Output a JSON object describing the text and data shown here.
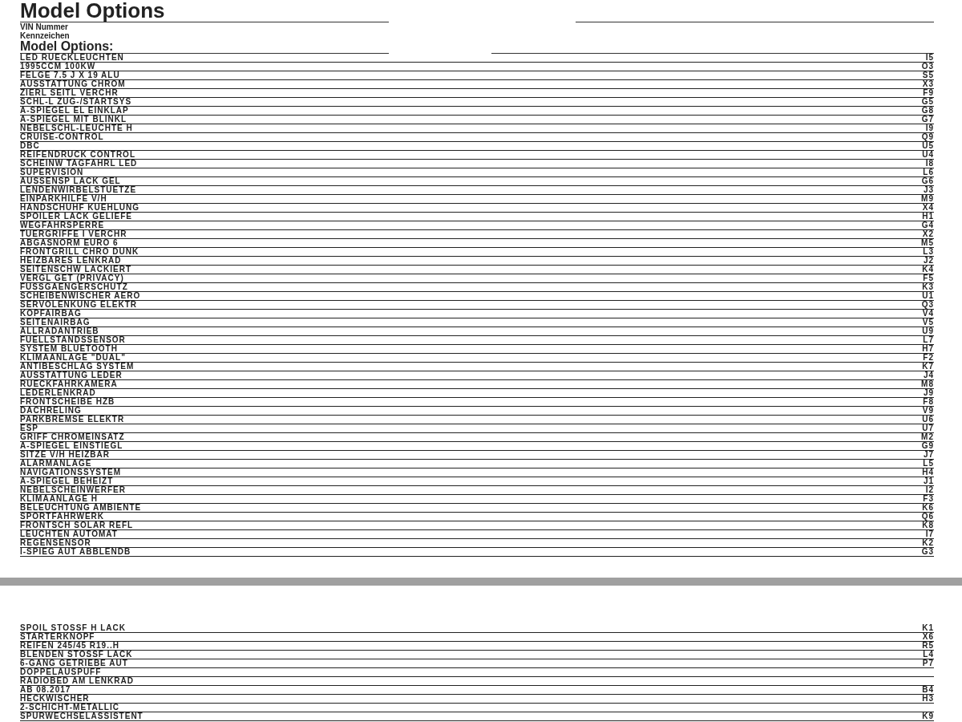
{
  "pages": [
    {
      "title": "Model Options",
      "fields": [
        "VIN Nummer",
        "Kennzeichen"
      ],
      "section_heading": "Model Options:",
      "options": [
        {
          "name": "LED RUECKLEUCHTEN",
          "code": "I5"
        },
        {
          "name": "1995CCM 100KW",
          "code": "O3"
        },
        {
          "name": "FELGE 7.5 J X 19 ALU",
          "code": "S5"
        },
        {
          "name": "AUSSTATTUNG CHROM",
          "code": "X3"
        },
        {
          "name": "ZIERL SEITL VERCHR",
          "code": "F9"
        },
        {
          "name": "SCHL-L ZUG-/STARTSYS",
          "code": "G5"
        },
        {
          "name": "A-SPIEGEL EL EINKLAP",
          "code": "G8"
        },
        {
          "name": "A-SPIEGEL MIT BLINKL",
          "code": "G7"
        },
        {
          "name": "NEBELSCHL-LEUCHTE H",
          "code": "I9"
        },
        {
          "name": "CRUISE-CONTROL",
          "code": "Q9"
        },
        {
          "name": "DBC",
          "code": "U5"
        },
        {
          "name": "REIFENDRUCK CONTROL",
          "code": "U4"
        },
        {
          "name": "SCHEINW TAGFAHRL LED",
          "code": "I8"
        },
        {
          "name": "SUPERVISION",
          "code": "L6"
        },
        {
          "name": "AUSSENSP LACK GEL",
          "code": "G6"
        },
        {
          "name": "LENDENWIRBELSTUETZE",
          "code": "J3"
        },
        {
          "name": "EINPARKHILFE V/H",
          "code": "M9"
        },
        {
          "name": "HANDSCHUHF KUEHLUNG",
          "code": "X4"
        },
        {
          "name": "SPOILER LACK GELIEFE",
          "code": "H1"
        },
        {
          "name": "WEGFAHRSPERRE",
          "code": "G4"
        },
        {
          "name": "TUERGRIFFE I VERCHR",
          "code": "X2"
        },
        {
          "name": "ABGASNORM EURO 6",
          "code": "M5"
        },
        {
          "name": "FRONTGRILL CHRO DUNK",
          "code": "L3"
        },
        {
          "name": "HEIZBARES LENKRAD",
          "code": "J2"
        },
        {
          "name": "SEITENSCHW LACKIERT",
          "code": "K4"
        },
        {
          "name": "VERGL GET (PRIVACY)",
          "code": "F5"
        },
        {
          "name": "FUSSGAENGERSCHUTZ",
          "code": "K3"
        },
        {
          "name": "SCHEIBENWISCHER AERO",
          "code": "U1"
        },
        {
          "name": "SERVOLENKUNG ELEKTR",
          "code": "Q3"
        },
        {
          "name": "KOPFAIRBAG",
          "code": "V4"
        },
        {
          "name": "SEITENAIRBAG",
          "code": "V5"
        },
        {
          "name": "ALLRADANTRIEB",
          "code": "U9"
        },
        {
          "name": "FUELLSTANDSSENSOR",
          "code": "L7"
        },
        {
          "name": "SYSTEM BLUETOOTH",
          "code": "H7"
        },
        {
          "name": "KLIMAANLAGE \"DUAL\"",
          "code": "F2"
        },
        {
          "name": "ANTIBESCHLAG SYSTEM",
          "code": "K7"
        },
        {
          "name": "AUSSTATTUNG LEDER",
          "code": "J4"
        },
        {
          "name": "RUECKFAHRKAMERA",
          "code": "M8"
        },
        {
          "name": "LEDERLENKRAD",
          "code": "J9"
        },
        {
          "name": "FRONTSCHEIBE HZB",
          "code": "F8"
        },
        {
          "name": "DACHRELING",
          "code": "V9"
        },
        {
          "name": "PARKBREMSE ELEKTR",
          "code": "U6"
        },
        {
          "name": "ESP",
          "code": "U7"
        },
        {
          "name": "GRIFF CHROMEINSATZ",
          "code": "M2"
        },
        {
          "name": "A-SPIEGEL EINSTIEGL",
          "code": "G9"
        },
        {
          "name": "SITZE V/H HEIZBAR",
          "code": "J7"
        },
        {
          "name": "ALARMANLAGE",
          "code": "L5"
        },
        {
          "name": "NAVIGATIONSSYSTEM",
          "code": "H4"
        },
        {
          "name": "A-SPIEGEL BEHEIZT",
          "code": "J1"
        },
        {
          "name": "NEBELSCHEINWERFER",
          "code": "I2"
        },
        {
          "name": "KLIMAANLAGE H",
          "code": "F3"
        },
        {
          "name": "BELEUCHTUNG AMBIENTE",
          "code": "K6"
        },
        {
          "name": "SPORTFAHRWERK",
          "code": "Q6"
        },
        {
          "name": "FRONTSCH SOLAR REFL",
          "code": "K8"
        },
        {
          "name": "LEUCHTEN AUTOMAT",
          "code": "I7"
        },
        {
          "name": "REGENSENSOR",
          "code": "K2"
        },
        {
          "name": "I-SPIEG AUT ABBLENDB",
          "code": "G3"
        }
      ]
    },
    {
      "options": [
        {
          "name": "SPOIL STOSSF H LACK",
          "code": "K1"
        },
        {
          "name": "STARTERKNOPF",
          "code": "X6"
        },
        {
          "name": "REIFEN 245/45 R19..H",
          "code": "R5"
        },
        {
          "name": "BLENDEN STOSSF LACK",
          "code": "L4"
        },
        {
          "name": "6-GANG GETRIEBE AUT",
          "code": "P7"
        },
        {
          "name": "DOPPELAUSPUFF"
        },
        {
          "name": "RADIOBED AM LENKRAD"
        },
        {
          "name": "AB 08.2017",
          "code": "B4"
        },
        {
          "name": "HECKWISCHER",
          "code": "H3"
        },
        {
          "name": "2-SCHICHT-METALLIC"
        },
        {
          "name": "SPURWECHSELASSISTENT",
          "code": "K9"
        }
      ]
    }
  ]
}
